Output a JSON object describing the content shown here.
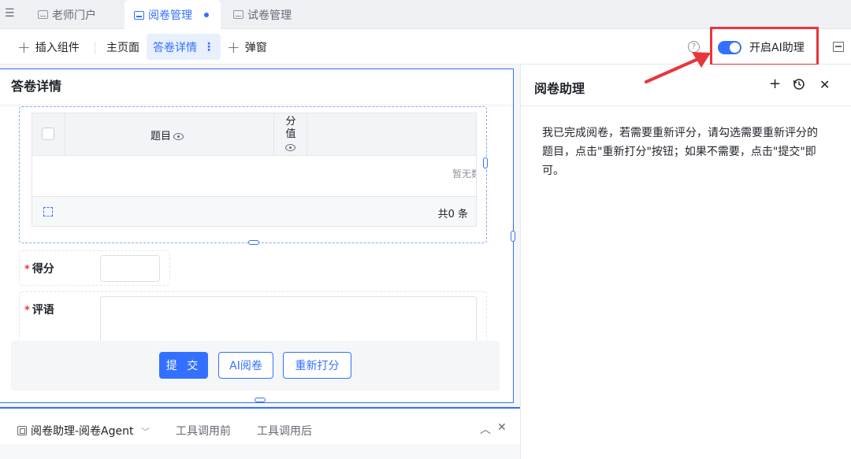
{
  "tabs": [
    {
      "label": "老师门户",
      "active": false
    },
    {
      "label": "阅卷管理",
      "active": true,
      "modified": true
    },
    {
      "label": "试卷管理",
      "active": false
    }
  ],
  "toolbar": {
    "insert_label": "插入组件",
    "main_page_label": "主页面",
    "detail_label": "答卷详情",
    "popup_label": "弹窗",
    "help_icon": "?",
    "ai_toggle_label": "开启AI助理",
    "ai_toggle_on": true
  },
  "form": {
    "title": "答卷详情",
    "table": {
      "columns": [
        "题目",
        "分值"
      ],
      "empty_text": "暂无数",
      "total_text": "共0 条"
    },
    "score_label": "得分",
    "comment_label": "评语",
    "required_mark": "*",
    "buttons": {
      "submit": "提 交",
      "ai_grade": "AI阅卷",
      "regrade": "重新打分"
    }
  },
  "bottom_panel": {
    "agent_tab": "阅卷助理-阅卷Agent",
    "tool_before": "工具调用前",
    "tool_after": "工具调用后"
  },
  "assistant": {
    "title": "阅卷助理",
    "message": "我已完成阅卷，若需要重新评分，请勾选需要重新评分的题目，点击\"重新打分\"按钮；如果不需要，点击\"提交\"即可。"
  },
  "colors": {
    "accent": "#3370ff",
    "highlight_red": "#e8363b"
  }
}
